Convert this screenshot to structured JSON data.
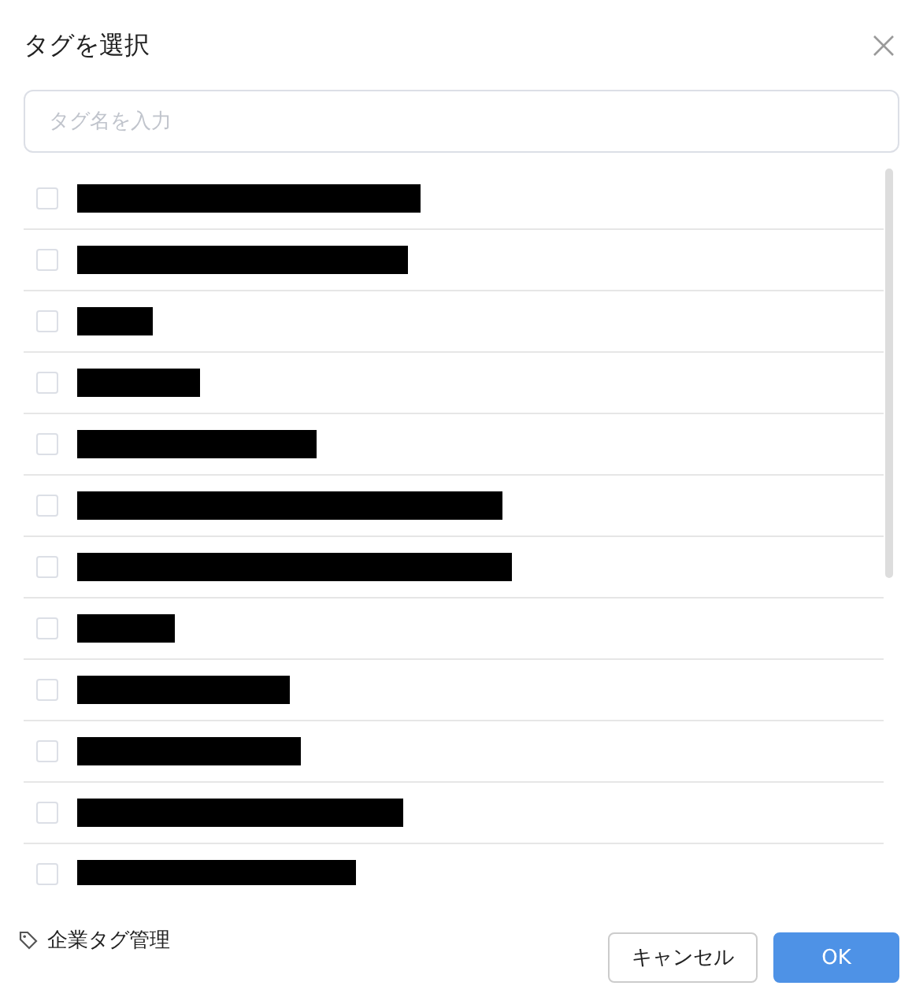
{
  "dialog": {
    "title": "タグを選択"
  },
  "search": {
    "placeholder": "タグ名を入力"
  },
  "tags": [
    {
      "checked": false,
      "redacted": true
    },
    {
      "checked": false,
      "redacted": true
    },
    {
      "checked": false,
      "redacted": true
    },
    {
      "checked": false,
      "redacted": true
    },
    {
      "checked": false,
      "redacted": true
    },
    {
      "checked": false,
      "redacted": true
    },
    {
      "checked": false,
      "redacted": true
    },
    {
      "checked": false,
      "redacted": true
    },
    {
      "checked": false,
      "redacted": true
    },
    {
      "checked": false,
      "redacted": true
    },
    {
      "checked": false,
      "redacted": true
    },
    {
      "checked": false,
      "redacted": true
    }
  ],
  "footer": {
    "manage_link": "企業タグ管理",
    "buttons": [
      {
        "label": "キャンセル",
        "kind": "secondary"
      },
      {
        "label": "OK",
        "kind": "primary"
      }
    ]
  }
}
